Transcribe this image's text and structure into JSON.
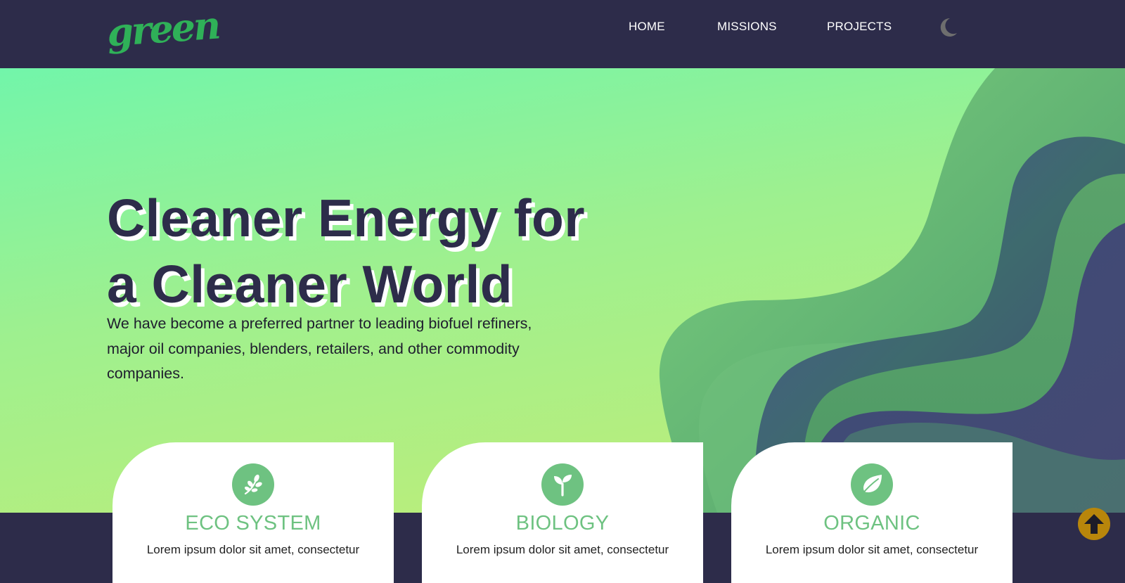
{
  "header": {
    "logo_text": "green",
    "nav": [
      {
        "label": "HOME"
      },
      {
        "label": "MISSIONS"
      },
      {
        "label": "PROJECTS"
      }
    ],
    "theme_toggle_icon": "moon-icon"
  },
  "hero": {
    "title_line1": "Cleaner Energy for",
    "title_line2": "a Cleaner World",
    "description": "We have become a preferred partner to leading biofuel refiners, major oil companies, blenders, retailers, and other commodity companies."
  },
  "cards": [
    {
      "icon": "herb-icon",
      "title": "ECO SYSTEM",
      "text": "Lorem ipsum dolor sit amet, consectetur"
    },
    {
      "icon": "sprout-icon",
      "title": "BIOLOGY",
      "text": "Lorem ipsum dolor sit amet, consectetur"
    },
    {
      "icon": "leaf-icon",
      "title": "ORGANIC",
      "text": "Lorem ipsum dolor sit amet, consectetur"
    }
  ],
  "scroll_top_icon": "arrow-up-icon",
  "colors": {
    "navy": "#2d2c4a",
    "brand_green": "#2fb158",
    "card_accent": "#6ec281",
    "scroll_button": "#b8860b"
  }
}
